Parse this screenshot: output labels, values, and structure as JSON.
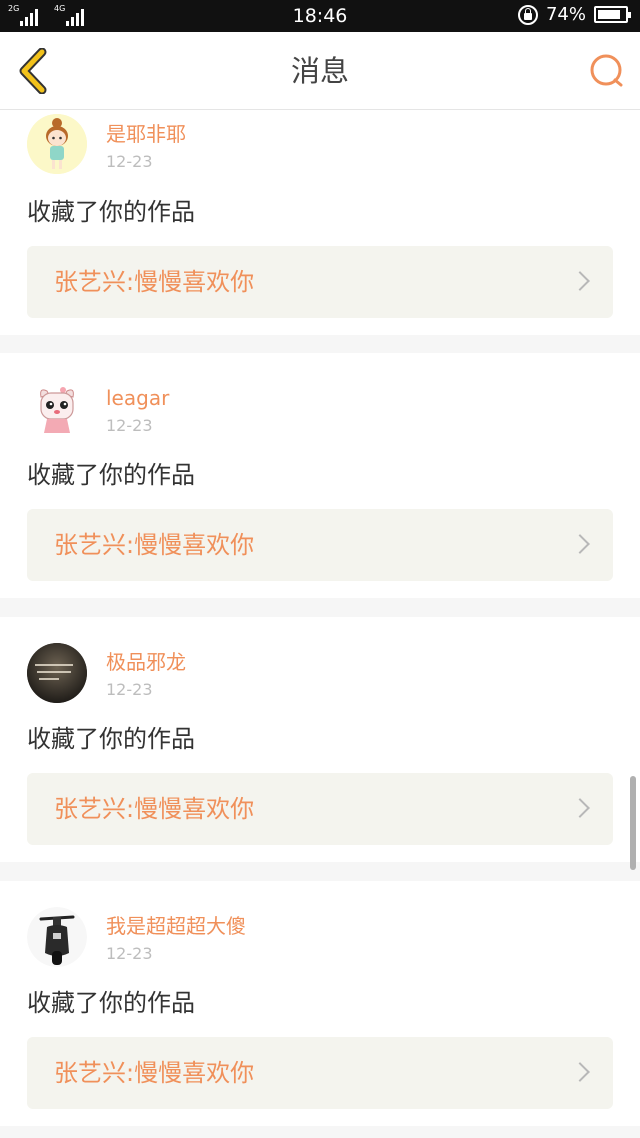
{
  "status_bar": {
    "network_1": "2G",
    "network_2": "4G",
    "time": "18:46",
    "battery": "74%"
  },
  "header": {
    "title": "消息",
    "back_icon": "chevron-left-icon",
    "search_icon": "search-icon"
  },
  "messages": [
    {
      "username": "是耶非耶",
      "date": "12-23",
      "action": "收藏了你的作品",
      "work": "张艺兴:慢慢喜欢你"
    },
    {
      "username": "leagar",
      "date": "12-23",
      "action": "收藏了你的作品",
      "work": "张艺兴:慢慢喜欢你"
    },
    {
      "username": "极品邪龙",
      "date": "12-23",
      "action": "收藏了你的作品",
      "work": "张艺兴:慢慢喜欢你"
    },
    {
      "username": "我是超超超大傻",
      "date": "12-23",
      "action": "收藏了你的作品",
      "work": "张艺兴:慢慢喜欢你"
    }
  ],
  "colors": {
    "accent": "#f0905a",
    "back_icon": "#f2c21b",
    "status_bar": "#111111",
    "card_link_bg": "#f4f4ee"
  }
}
